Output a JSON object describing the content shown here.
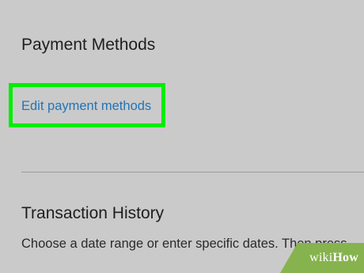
{
  "payment_methods": {
    "title": "Payment Methods",
    "edit_link_label": "Edit payment methods"
  },
  "transaction_history": {
    "title": "Transaction History",
    "description": "Choose a date range or enter specific dates. Then press"
  },
  "watermark": {
    "prefix": "wiki",
    "suffix": "How"
  },
  "colors": {
    "background": "#cacaca",
    "link": "#2274b8",
    "highlight": "#00ee00",
    "watermark_bg": "#86b34e"
  }
}
